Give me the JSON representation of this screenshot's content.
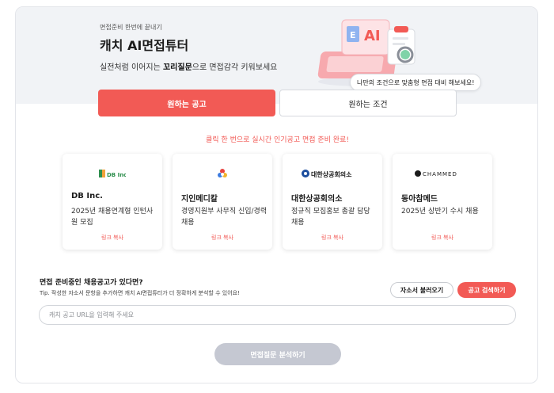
{
  "header": {
    "eyebrow": "면접준비 한번에 끝내기",
    "title": "캐치 AI면접튜터",
    "desc_prefix": "실전처럼 이어지는 ",
    "desc_bold": "꼬리질문",
    "desc_suffix": "으로 면접감각 키워보세요"
  },
  "tabs": [
    {
      "label": "원하는 공고",
      "active": true
    },
    {
      "label": "원하는 조건",
      "active": false
    }
  ],
  "tooltip": "나만의 조건으로 맞춤형 면접 대비 해보세요!",
  "promo": "클릭 한 번으로 실시간 인기공고 면접 준비 완료!",
  "jobs": [
    {
      "logo": "DB Inc.",
      "company": "DB Inc.",
      "title": "2025년 채용연계형 인턴사원 모집",
      "link": "링크 복사"
    },
    {
      "logo": "",
      "company": "지인메디칼",
      "title": "경영지원부 사무직 신입/경력 채용",
      "link": "링크 복사"
    },
    {
      "logo": "대한상공회의소",
      "company": "대한상공회의소",
      "title": "정규직 모집홍보 총괄 담당 채용",
      "link": "링크 복사"
    },
    {
      "logo": "CHAMMED",
      "company": "동아참메드",
      "title": "2025년 상반기 수시 채용",
      "link": "링크 복사"
    }
  ],
  "question": {
    "title": "면접 준비중인 채용공고가 있다면?",
    "tip": "Tip. 작성한 자소서 문항을 추가하면 캐치 AI면접튜터가 더 정확하게 분석할 수 있어요!",
    "load_button": "자소서 불러오기",
    "search_button": "공고 검색하기",
    "input_placeholder": "캐치 공고 URL을 입력해 주세요",
    "input_value": "",
    "analyze_button": "면접질문 분석하기"
  },
  "colors": {
    "accent": "#f25a55",
    "header_bg": "#f1f3f6",
    "disabled_button": "#c5c8d2"
  },
  "icons": [
    "ai-laptop-illustration",
    "db-logo-icon",
    "jiin-logo-icon",
    "kcci-logo-icon",
    "chammed-logo-icon"
  ]
}
